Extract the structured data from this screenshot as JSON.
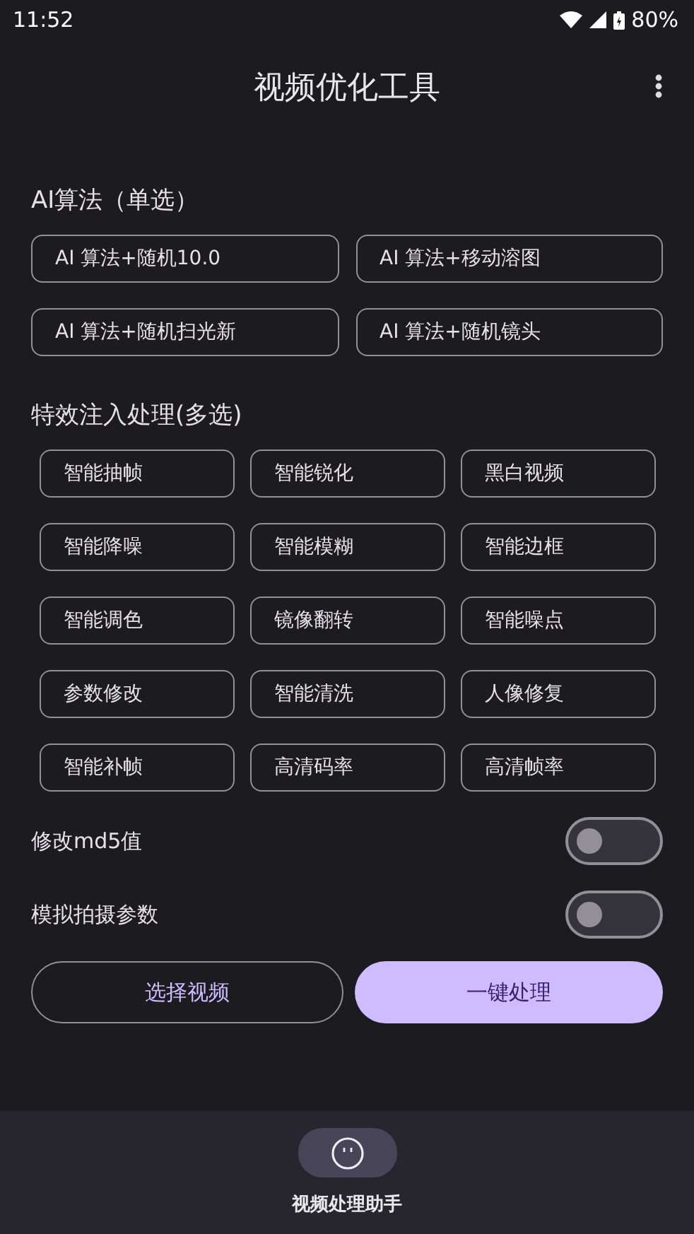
{
  "status_bar": {
    "time": "11:52",
    "battery": "80%"
  },
  "app_bar": {
    "title": "视频优化工具"
  },
  "algorithm_section": {
    "title": "AI算法（单选）",
    "options": [
      {
        "label": "AI 算法+随机10.0",
        "selected": false
      },
      {
        "label": "AI 算法+移动溶图",
        "selected": false
      },
      {
        "label": "AI 算法+随机扫光新",
        "selected": false
      },
      {
        "label": "AI 算法+随机镜头",
        "selected": false
      }
    ]
  },
  "effects_section": {
    "title": "特效注入处理(多选)",
    "options": [
      {
        "label": "智能抽帧",
        "selected": false
      },
      {
        "label": "智能锐化",
        "selected": false
      },
      {
        "label": "黑白视频",
        "selected": false
      },
      {
        "label": "智能降噪",
        "selected": false
      },
      {
        "label": "智能模糊",
        "selected": false
      },
      {
        "label": "智能边框",
        "selected": false
      },
      {
        "label": "智能调色",
        "selected": false
      },
      {
        "label": "镜像翻转",
        "selected": false
      },
      {
        "label": "智能噪点",
        "selected": false
      },
      {
        "label": "参数修改",
        "selected": false
      },
      {
        "label": "智能清洗",
        "selected": false
      },
      {
        "label": "人像修复",
        "selected": false
      },
      {
        "label": "智能补帧",
        "selected": false
      },
      {
        "label": "高清码率",
        "selected": false
      },
      {
        "label": "高清帧率",
        "selected": false
      }
    ]
  },
  "settings": [
    {
      "label": "修改md5值",
      "on": false
    },
    {
      "label": "模拟拍摄参数",
      "on": false
    }
  ],
  "buttons": [
    {
      "label": "选择视频",
      "kind": "outlined"
    },
    {
      "label": "一键处理",
      "kind": "filled"
    }
  ],
  "bottom_nav": {
    "items": [
      {
        "label": "视频处理助手",
        "selected": true
      }
    ]
  }
}
